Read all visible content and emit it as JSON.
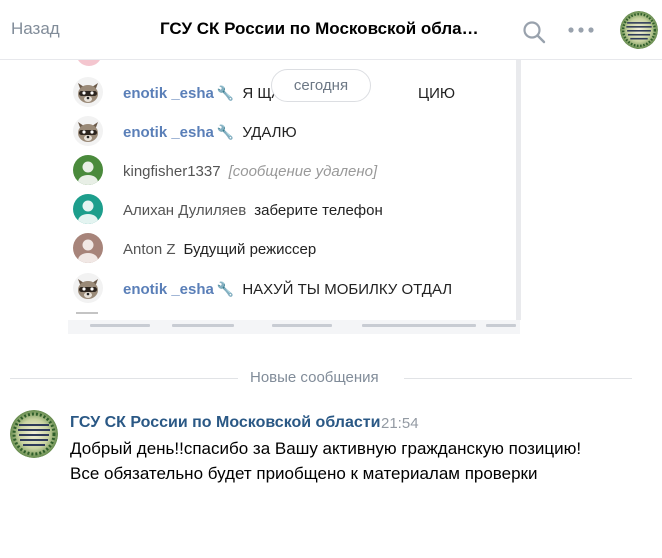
{
  "header": {
    "back_label": "Назад",
    "title": "ГСУ СК России по Московской обла…",
    "logo_text": "ГЛАВНОЕ СЛЕДСТВЕННОЕ УПРАВЛЕНИЕ ПО МОСКОВСКОЙ ОБЛАСТИ"
  },
  "attachment": {
    "date_pill": "сегодня",
    "rows": [
      {
        "nick": "enotik _esha",
        "moderator": true,
        "message": "Я ЩА",
        "message_tail": "ЦИЮ",
        "deleted": false,
        "avatar": "raccoon"
      },
      {
        "nick": "enotik _esha",
        "moderator": true,
        "message": "УДАЛЮ",
        "message_tail": "",
        "deleted": false,
        "avatar": "raccoon"
      },
      {
        "nick": "kingfisher1337",
        "moderator": false,
        "message": "[сообщение удалено]",
        "message_tail": "",
        "deleted": true,
        "avatar": "default-green"
      },
      {
        "nick": "Алихан Дулиляев",
        "moderator": false,
        "message": "заберите телефон",
        "message_tail": "",
        "deleted": false,
        "avatar": "default-teal"
      },
      {
        "nick": "Anton Z",
        "moderator": false,
        "message": "Будущий режиссер",
        "message_tail": "",
        "deleted": false,
        "avatar": "default-brown"
      },
      {
        "nick": "enotik _esha",
        "moderator": true,
        "message": "НАХУЙ ТЫ МОБИЛКУ ОТДАЛ",
        "message_tail": "",
        "deleted": false,
        "avatar": "raccoon"
      }
    ]
  },
  "divider": {
    "label": "Новые сообщения"
  },
  "message": {
    "author": "ГСУ СК России по Московской области",
    "time": "21:54",
    "text": "Добрый день!!спасибо за Вашу активную гражданскую позицию! Все обязательно будет приобщено к материалам проверки"
  },
  "colors": {
    "link": "#2a5885",
    "muted": "#818c99",
    "nick": "#5a7fb8"
  },
  "icons": {
    "search": "search-icon",
    "more": "more-icon",
    "moderator": "wrench-icon"
  }
}
